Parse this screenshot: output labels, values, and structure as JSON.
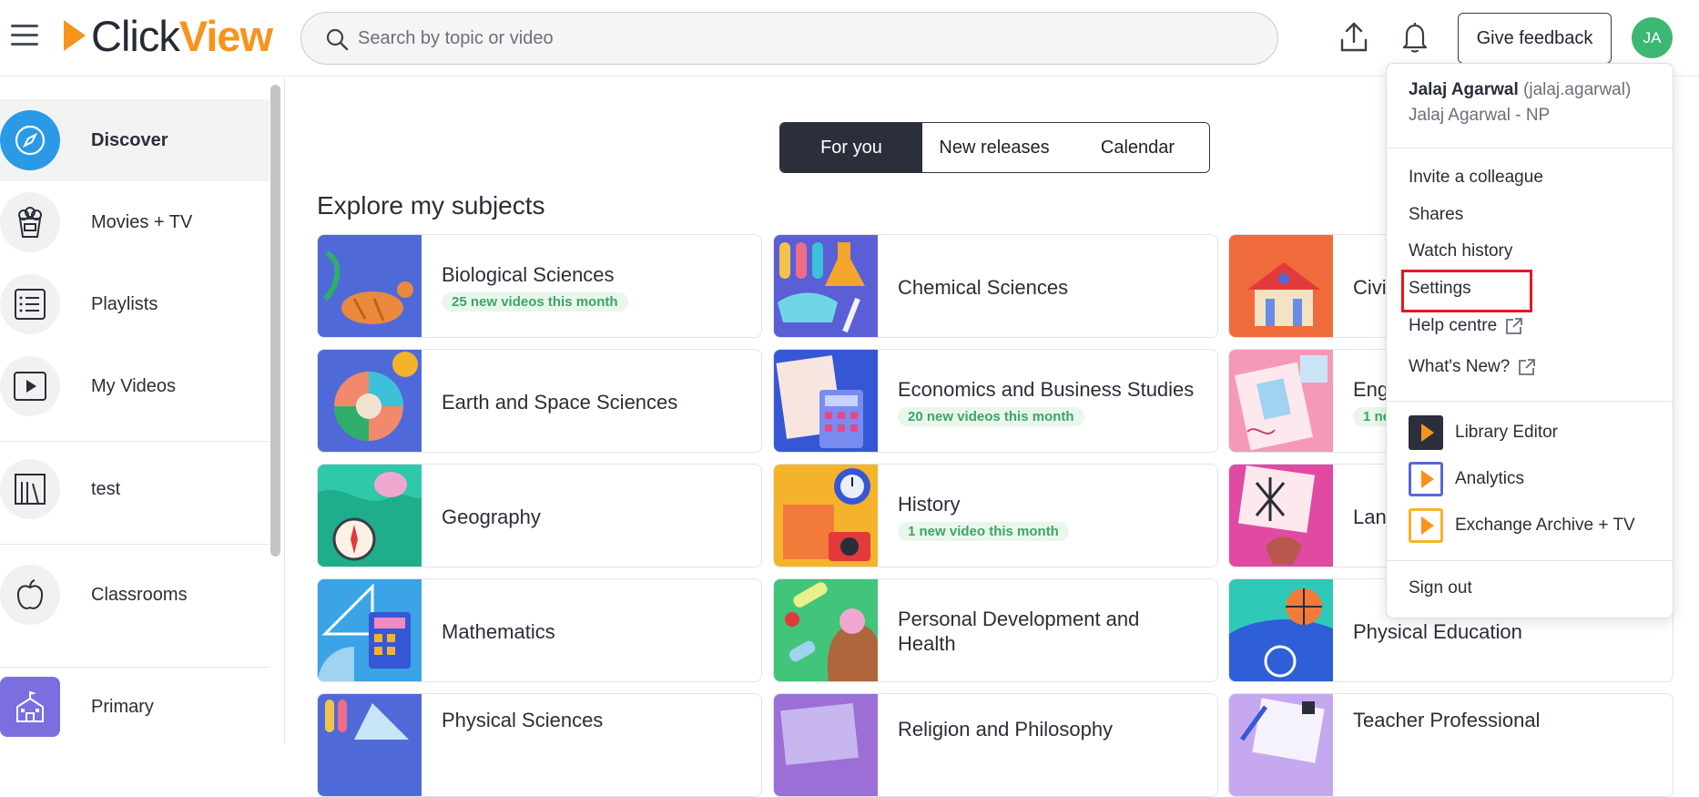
{
  "header": {
    "logo_click": "Click",
    "logo_view": "View",
    "search_placeholder": "Search by topic or video",
    "feedback_label": "Give feedback",
    "avatar_initials": "JA"
  },
  "sidebar": {
    "items": [
      {
        "label": "Discover",
        "icon": "compass-icon"
      },
      {
        "label": "Movies + TV",
        "icon": "popcorn-icon"
      },
      {
        "label": "Playlists",
        "icon": "list-icon"
      },
      {
        "label": "My Videos",
        "icon": "play-box-icon"
      },
      {
        "label": "test",
        "icon": "books-icon"
      },
      {
        "label": "Classrooms",
        "icon": "apple-icon"
      },
      {
        "label": "Primary",
        "icon": "school-icon"
      }
    ]
  },
  "tabs": [
    {
      "label": "For you"
    },
    {
      "label": "New releases"
    },
    {
      "label": "Calendar"
    }
  ],
  "section_title": "Explore my subjects",
  "subjects": [
    {
      "name": "Biological Sciences",
      "badge": "25 new videos this month"
    },
    {
      "name": "Chemical Sciences",
      "badge": ""
    },
    {
      "name": "Civi",
      "badge": ""
    },
    {
      "name": "Earth and Space Sciences",
      "badge": ""
    },
    {
      "name": "Economics and Business Studies",
      "badge": "20 new videos this month"
    },
    {
      "name": "Eng",
      "badge": "1 ne"
    },
    {
      "name": "Geography",
      "badge": ""
    },
    {
      "name": "History",
      "badge": "1 new video this month"
    },
    {
      "name": "Lan",
      "badge": ""
    },
    {
      "name": "Mathematics",
      "badge": ""
    },
    {
      "name": "Personal Development and Health",
      "badge": ""
    },
    {
      "name": "Physical Education",
      "badge": ""
    },
    {
      "name": "Physical Sciences",
      "badge": ""
    },
    {
      "name": "Religion and Philosophy",
      "badge": ""
    },
    {
      "name": "Teacher Professional",
      "badge": ""
    }
  ],
  "menu": {
    "user_name": "Jalaj Agarwal",
    "username": "(jalaj.agarwal)",
    "org": "Jalaj Agarwal - NP",
    "items": [
      "Invite a colleague",
      "Shares",
      "Watch history",
      "Settings",
      "Help centre",
      "What's New?"
    ],
    "apps": [
      "Library Editor",
      "Analytics",
      "Exchange Archive + TV"
    ],
    "sign_out": "Sign out"
  },
  "colors": {
    "brand_orange": "#f7941d",
    "active_tab": "#2b2f3b",
    "discover_blue": "#2b9ae6",
    "badge_green": "#3ea564",
    "highlight_red": "#e2181f",
    "avatar_green": "#3cb872"
  }
}
